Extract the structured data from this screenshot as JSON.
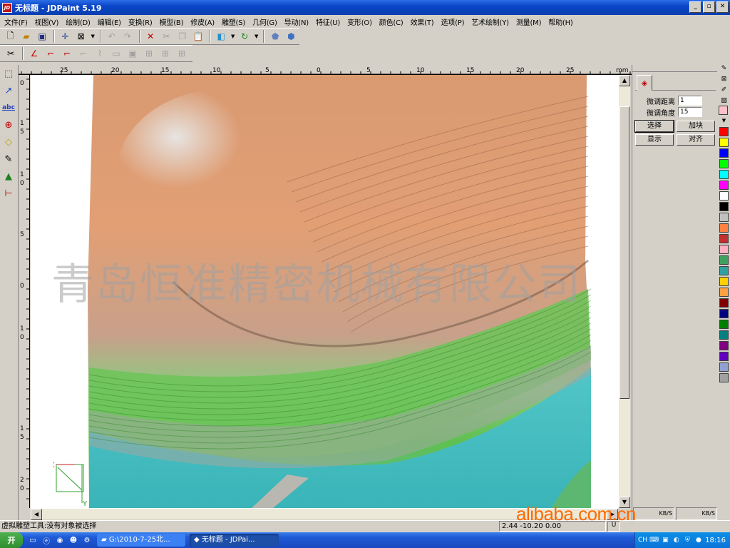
{
  "window": {
    "title": "无标题 - JDPaint 5.19",
    "app_icon": "JD"
  },
  "menu": [
    "文件(F)",
    "视图(V)",
    "绘制(D)",
    "编辑(E)",
    "变换(R)",
    "模型(B)",
    "修皮(A)",
    "雕塑(S)",
    "几何(G)",
    "导动(N)",
    "特征(U)",
    "变形(O)",
    "颜色(C)",
    "效果(T)",
    "选项(P)",
    "艺术绘制(Y)",
    "测量(M)",
    "帮助(H)"
  ],
  "ruler": {
    "top_labels": [
      "25",
      "20",
      "15",
      "10",
      "5",
      "0",
      "5",
      "10",
      "15",
      "20",
      "25"
    ],
    "unit": "mm",
    "left_labels": [
      "0",
      "1",
      "5",
      "1",
      "0",
      "5",
      "0",
      "1",
      "0",
      "1",
      "5",
      "2",
      "0"
    ]
  },
  "right_panel": {
    "fine_distance_label": "微调距离",
    "fine_distance_value": "1",
    "fine_angle_label": "微调角度",
    "fine_angle_value": "15",
    "buttons": [
      "选择",
      "加块",
      "显示",
      "对齐"
    ]
  },
  "palette_colors": [
    "#ff0000",
    "#ffff00",
    "#0000ff",
    "#00ff00",
    "#00ffff",
    "#ff00ff",
    "#ffffff",
    "#000000",
    "#c0c0c0",
    "#ff8040",
    "#c03030",
    "#ffb0c0",
    "#40a060",
    "#30a0a0",
    "#ffd000",
    "#ffa040",
    "#800000",
    "#000080",
    "#008000",
    "#008080",
    "#800080",
    "#6000c0",
    "#90a0d0",
    "#a0a0a0"
  ],
  "status": {
    "message": "虚拟雕塑工具:没有对象被选择",
    "coords": "2.44 -10.20 0.00",
    "mode": "U",
    "speed1": "KB/S",
    "speed2": "KB/S"
  },
  "taskbar": {
    "start": "开",
    "tasks": [
      "G:\\2010-7-25北...",
      "无标题 - JDPai..."
    ],
    "clock": "18:16",
    "lang": "CH"
  },
  "watermarks": {
    "company": "青岛恒准精密机械有限公司",
    "site": "alibaba.com.cn"
  },
  "axes": {
    "x": "X",
    "y": "Y"
  }
}
